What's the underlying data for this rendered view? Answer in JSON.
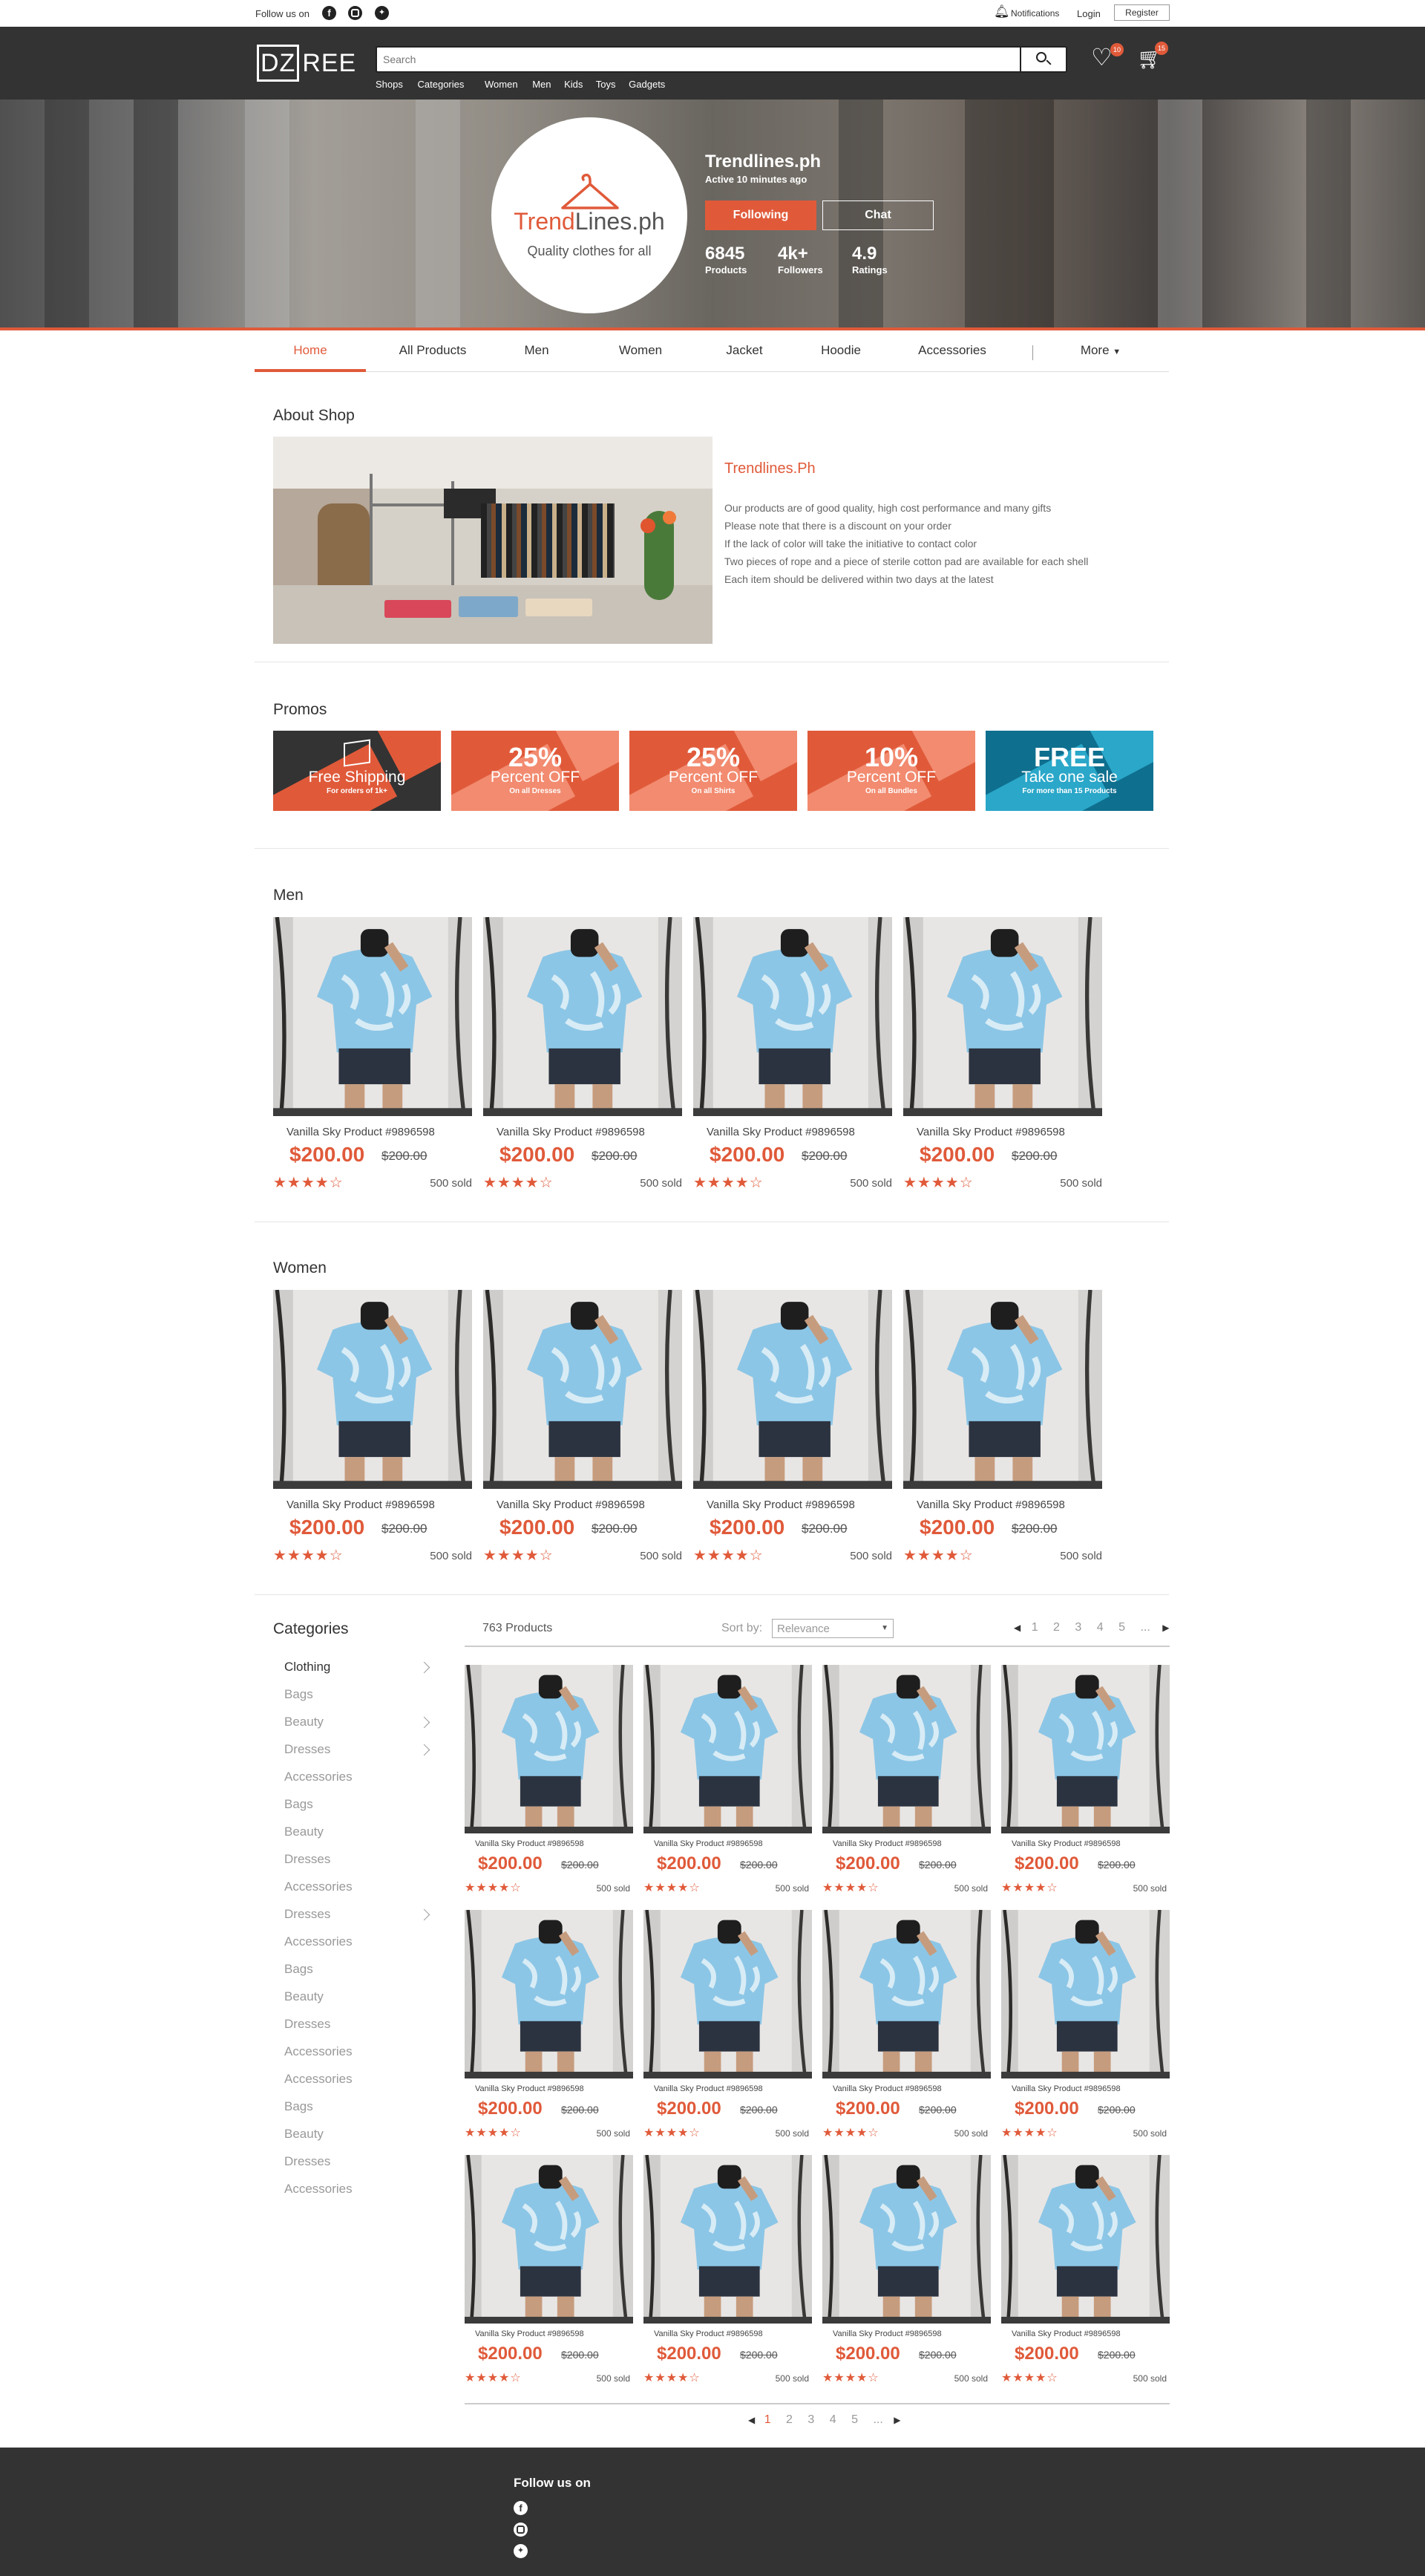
{
  "topbar": {
    "follow_label": "Follow us on",
    "notifications": "Notifications",
    "login": "Login",
    "register": "Register"
  },
  "header": {
    "logo_box": "DZ",
    "logo_rest": "REE",
    "search_placeholder": "Search",
    "wishlist_count": "10",
    "cart_count": "15",
    "nav": [
      "Shops",
      "Categories",
      "Women",
      "Men",
      "Kids",
      "Toys",
      "Gadgets"
    ]
  },
  "shop": {
    "logo_part1": "Trend",
    "logo_part2": "Lines.ph",
    "tagline": "Quality clothes for all",
    "name": "Trendlines.ph",
    "active": "Active 10 minutes ago",
    "follow_button": "Following",
    "chat_button": "Chat",
    "stats": [
      {
        "value": "6845",
        "label": "Products"
      },
      {
        "value": "4k+",
        "label": "Followers"
      },
      {
        "value": "4.9",
        "label": "Ratings"
      }
    ]
  },
  "tabs": [
    "Home",
    "All Products",
    "Men",
    "Women",
    "Jacket",
    "Hoodie",
    "Accessories",
    "More"
  ],
  "about": {
    "title": "About Shop",
    "shop_name": "Trendlines.Ph",
    "lines": [
      "Our products are of good quality, high cost performance and many gifts",
      "Please note that there is a discount on your order",
      "If the lack of color will take the initiative to contact color",
      "Two pieces of rope and a piece of sterile cotton pad are available for each shell",
      "Each item should be delivered within two days at the latest"
    ]
  },
  "promos": {
    "title": "Promos",
    "items": [
      {
        "big": "",
        "mid": "Free Shipping",
        "small": "For orders of 1k+",
        "bg": "#333333",
        "accent": "#e05a3a"
      },
      {
        "big": "25%",
        "mid": "Percent OFF",
        "small": "On all Dresses",
        "bg": "#e05a3a",
        "accent": "#f28b70"
      },
      {
        "big": "25%",
        "mid": "Percent OFF",
        "small": "On all Shirts",
        "bg": "#e05a3a",
        "accent": "#f28b70"
      },
      {
        "big": "10%",
        "mid": "Percent OFF",
        "small": "On all Bundles",
        "bg": "#e05a3a",
        "accent": "#f28b70"
      },
      {
        "big": "FREE",
        "mid": "Take one sale",
        "small": "For more than 15 Products",
        "bg": "#0f6f8f",
        "accent": "#2aa7c9"
      }
    ]
  },
  "product": {
    "name": "Vanilla Sky Product #9896598",
    "price": "$200.00",
    "old_price": "$200.00",
    "stars": "★★★★☆",
    "sold": "500 sold"
  },
  "men_title": "Men",
  "women_title": "Women",
  "categories": {
    "title": "Categories",
    "items": [
      "Clothing",
      "Bags",
      "Beauty",
      "Dresses",
      "Accessories",
      "Bags",
      "Beauty",
      "Dresses",
      "Accessories",
      "Dresses",
      "Accessories",
      "Bags",
      "Beauty",
      "Dresses",
      "Accessories",
      "Accessories",
      "Bags",
      "Beauty",
      "Dresses",
      "Accessories"
    ]
  },
  "listing": {
    "count": "763 Products",
    "sort_label": "Sort by:",
    "sort_value": "Relevance",
    "pages": [
      "1",
      "2",
      "3",
      "4",
      "5",
      "..."
    ]
  },
  "footer": {
    "follow_label": "Follow us on"
  },
  "colors": {
    "accent": "#e05a3a",
    "dark": "#333333",
    "teal": "#0f6f8f"
  }
}
